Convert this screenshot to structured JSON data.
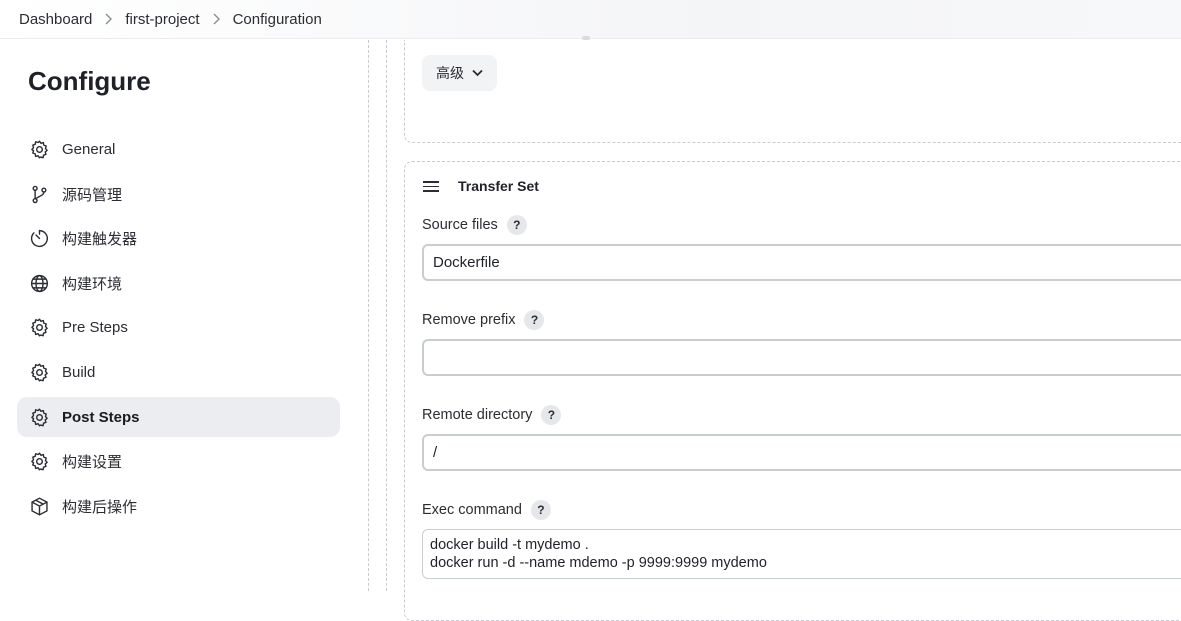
{
  "breadcrumb": {
    "items": [
      "Dashboard",
      "first-project",
      "Configuration"
    ]
  },
  "sidebar": {
    "title": "Configure",
    "items": [
      {
        "label": "General",
        "icon": "gear-icon",
        "active": false
      },
      {
        "label": "源码管理",
        "icon": "source-branch-icon",
        "active": false
      },
      {
        "label": "构建触发器",
        "icon": "timer-icon",
        "active": false
      },
      {
        "label": "构建环境",
        "icon": "globe-icon",
        "active": false
      },
      {
        "label": "Pre Steps",
        "icon": "gear-icon",
        "active": false
      },
      {
        "label": "Build",
        "icon": "gear-icon",
        "active": false
      },
      {
        "label": "Post Steps",
        "icon": "gear-icon",
        "active": true
      },
      {
        "label": "构建设置",
        "icon": "gear-icon",
        "active": false
      },
      {
        "label": "构建后操作",
        "icon": "package-icon",
        "active": false
      }
    ]
  },
  "advanced": {
    "button_label": "高级"
  },
  "transfer_set": {
    "title": "Transfer Set",
    "help_label": "?",
    "source_files": {
      "label": "Source files",
      "value": "Dockerfile"
    },
    "remove_prefix": {
      "label": "Remove prefix",
      "value": ""
    },
    "remote_directory": {
      "label": "Remote directory",
      "value": "/"
    },
    "exec_command": {
      "label": "Exec command",
      "value": "docker build -t mydemo .\ndocker run -d --name mdemo -p 9999:9999 mydemo"
    }
  }
}
